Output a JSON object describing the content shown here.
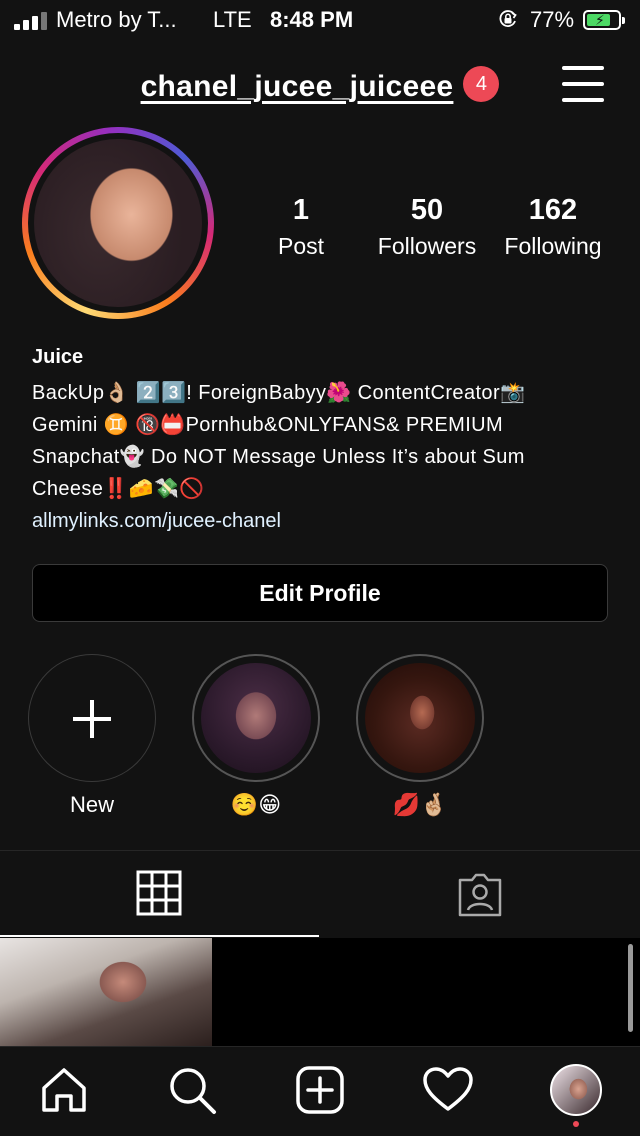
{
  "status_bar": {
    "carrier": "Metro by T...",
    "network": "LTE",
    "time": "8:48 PM",
    "battery_percent": "77%",
    "battery_level": 0.77,
    "icons": [
      "signal-icon",
      "orientation-lock-icon",
      "battery-charging-icon"
    ]
  },
  "header": {
    "username": "chanel_jucee_juiceee",
    "notification_count": "4",
    "menu_icon": "hamburger-menu-icon"
  },
  "stats": [
    {
      "value": "1",
      "label": "Post"
    },
    {
      "value": "50",
      "label": "Followers"
    },
    {
      "value": "162",
      "label": "Following"
    }
  ],
  "bio": {
    "name": "Juice",
    "lines": [
      "BackUp👌🏼 2️⃣3️⃣! ForeignBabyy🌺 ContentCreator📸",
      "Gemini ♊️ 🔞📛Pornhub&ONLYFANS& PREMIUM",
      "Snapchat👻 Do NOT Message Unless It’s about Sum",
      "Cheese‼️🧀💸🚫"
    ],
    "link": "allmylinks.com/jucee-chanel"
  },
  "edit_profile_label": "Edit Profile",
  "highlights": [
    {
      "label": "New"
    },
    {
      "label": "☺️😁"
    },
    {
      "label": "💋🤞🏼"
    }
  ],
  "tabs": [
    "grid-icon",
    "tagged-icon"
  ],
  "nav": [
    "home-icon",
    "search-icon",
    "new-post-icon",
    "activity-heart-icon",
    "profile-avatar"
  ],
  "colors": {
    "background": "#121212",
    "badge": "#ed4956",
    "battery": "#4cd964"
  }
}
